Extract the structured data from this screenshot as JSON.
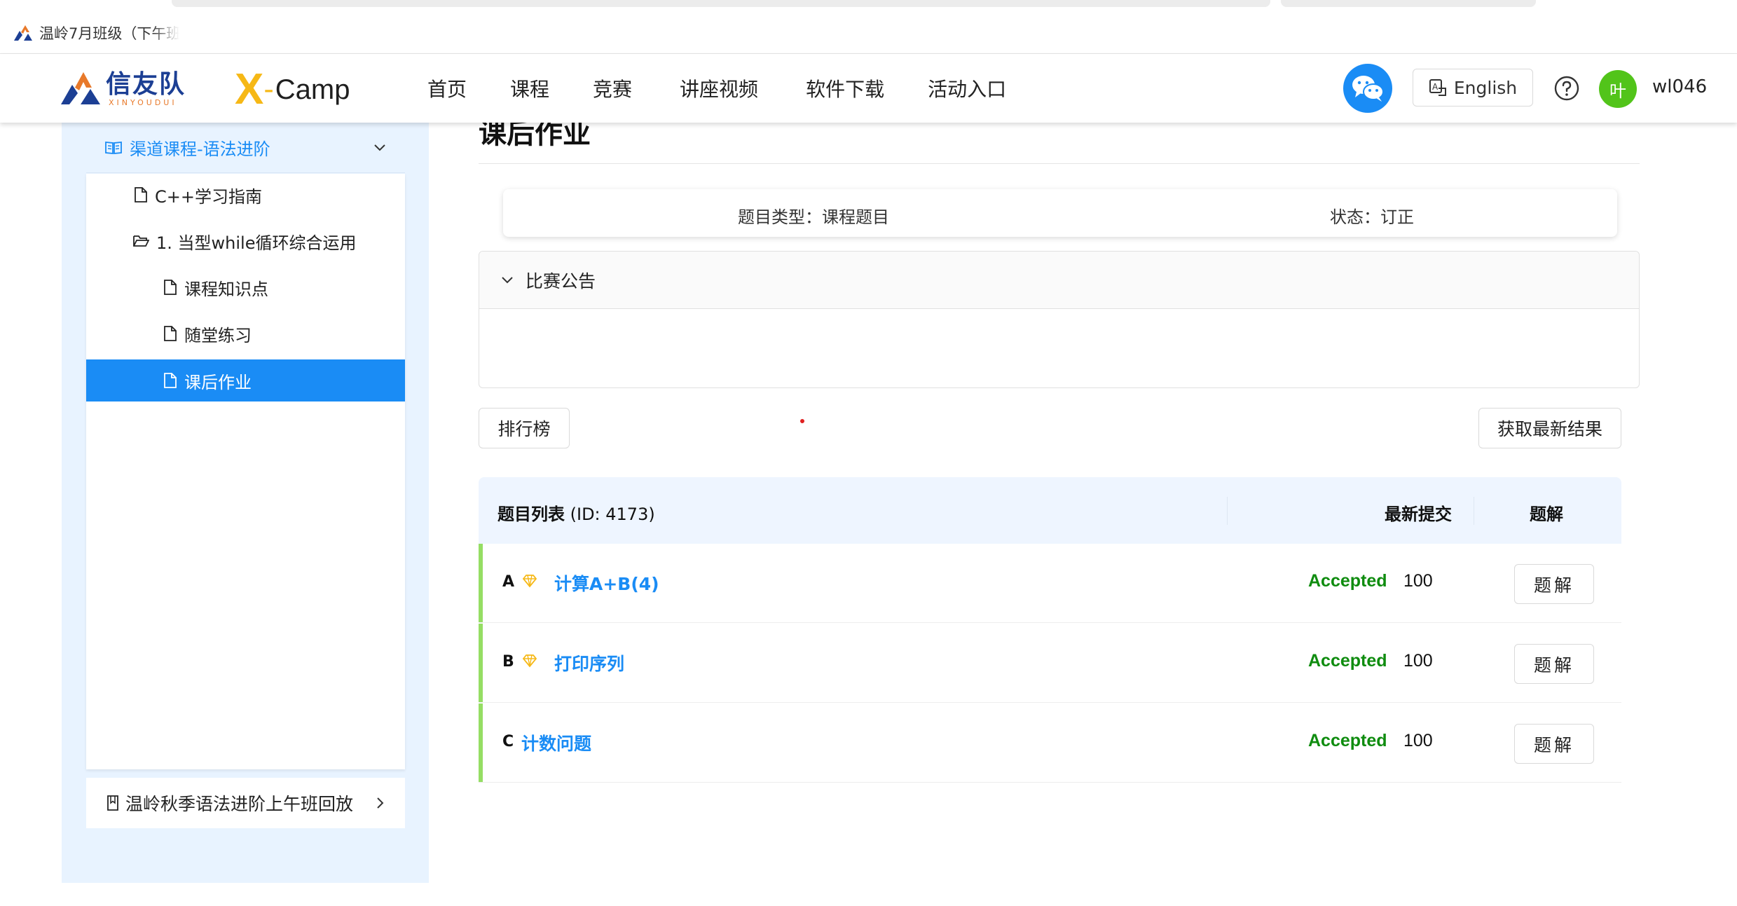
{
  "browser": {
    "tab_title": "温岭7月班级（下午班"
  },
  "header": {
    "logo_main": "信友队",
    "logo_sub": "XINYOUDUI",
    "logo2_x": "X",
    "logo2_dash": "-",
    "logo2_camp": "Camp",
    "nav": [
      "首页",
      "课程",
      "竞赛",
      "讲座视频",
      "软件下载",
      "活动入口"
    ],
    "language": "English",
    "avatar_initial": "叶",
    "username": "wl046"
  },
  "sidebar": {
    "group_label": "渠道课程-语法进阶",
    "items": [
      {
        "label": "C++学习指南",
        "icon": "file-icon"
      },
      {
        "label": "1. 当型while循环综合运用",
        "icon": "folder-open-icon"
      },
      {
        "label": "课程知识点",
        "icon": "file-icon"
      },
      {
        "label": "随堂练习",
        "icon": "file-icon"
      },
      {
        "label": "课后作业",
        "icon": "file-icon",
        "active": true
      }
    ],
    "bottom_label": "温岭秋季语法进阶上午班回放"
  },
  "main": {
    "title": "课后作业",
    "info_type": "题目类型：课程题目",
    "info_status": "状态：订正",
    "announcement_label": "比赛公告",
    "rank_button": "排行榜",
    "refresh_button": "获取最新结果",
    "table": {
      "title_bold": "题目列表",
      "title_id": " (ID: 4173)",
      "col_latest": "最新提交",
      "col_solution": "题解",
      "rows": [
        {
          "letter": "A",
          "name": "计算A+B(4)",
          "gem": true,
          "status": "Accepted",
          "score": "100",
          "solution": "题解"
        },
        {
          "letter": "B",
          "name": "打印序列",
          "gem": true,
          "status": "Accepted",
          "score": "100",
          "solution": "题解"
        },
        {
          "letter": "C",
          "name": "计数问题",
          "gem": false,
          "status": "Accepted",
          "score": "100",
          "solution": "题解"
        }
      ]
    }
  },
  "colors": {
    "primary": "#1a8cf5",
    "accepted": "#0f8c0f",
    "row_accent": "#95de64",
    "sidebar_bg": "#e8f3ff",
    "avatar": "#52c41a",
    "gem": "#f6b816"
  }
}
